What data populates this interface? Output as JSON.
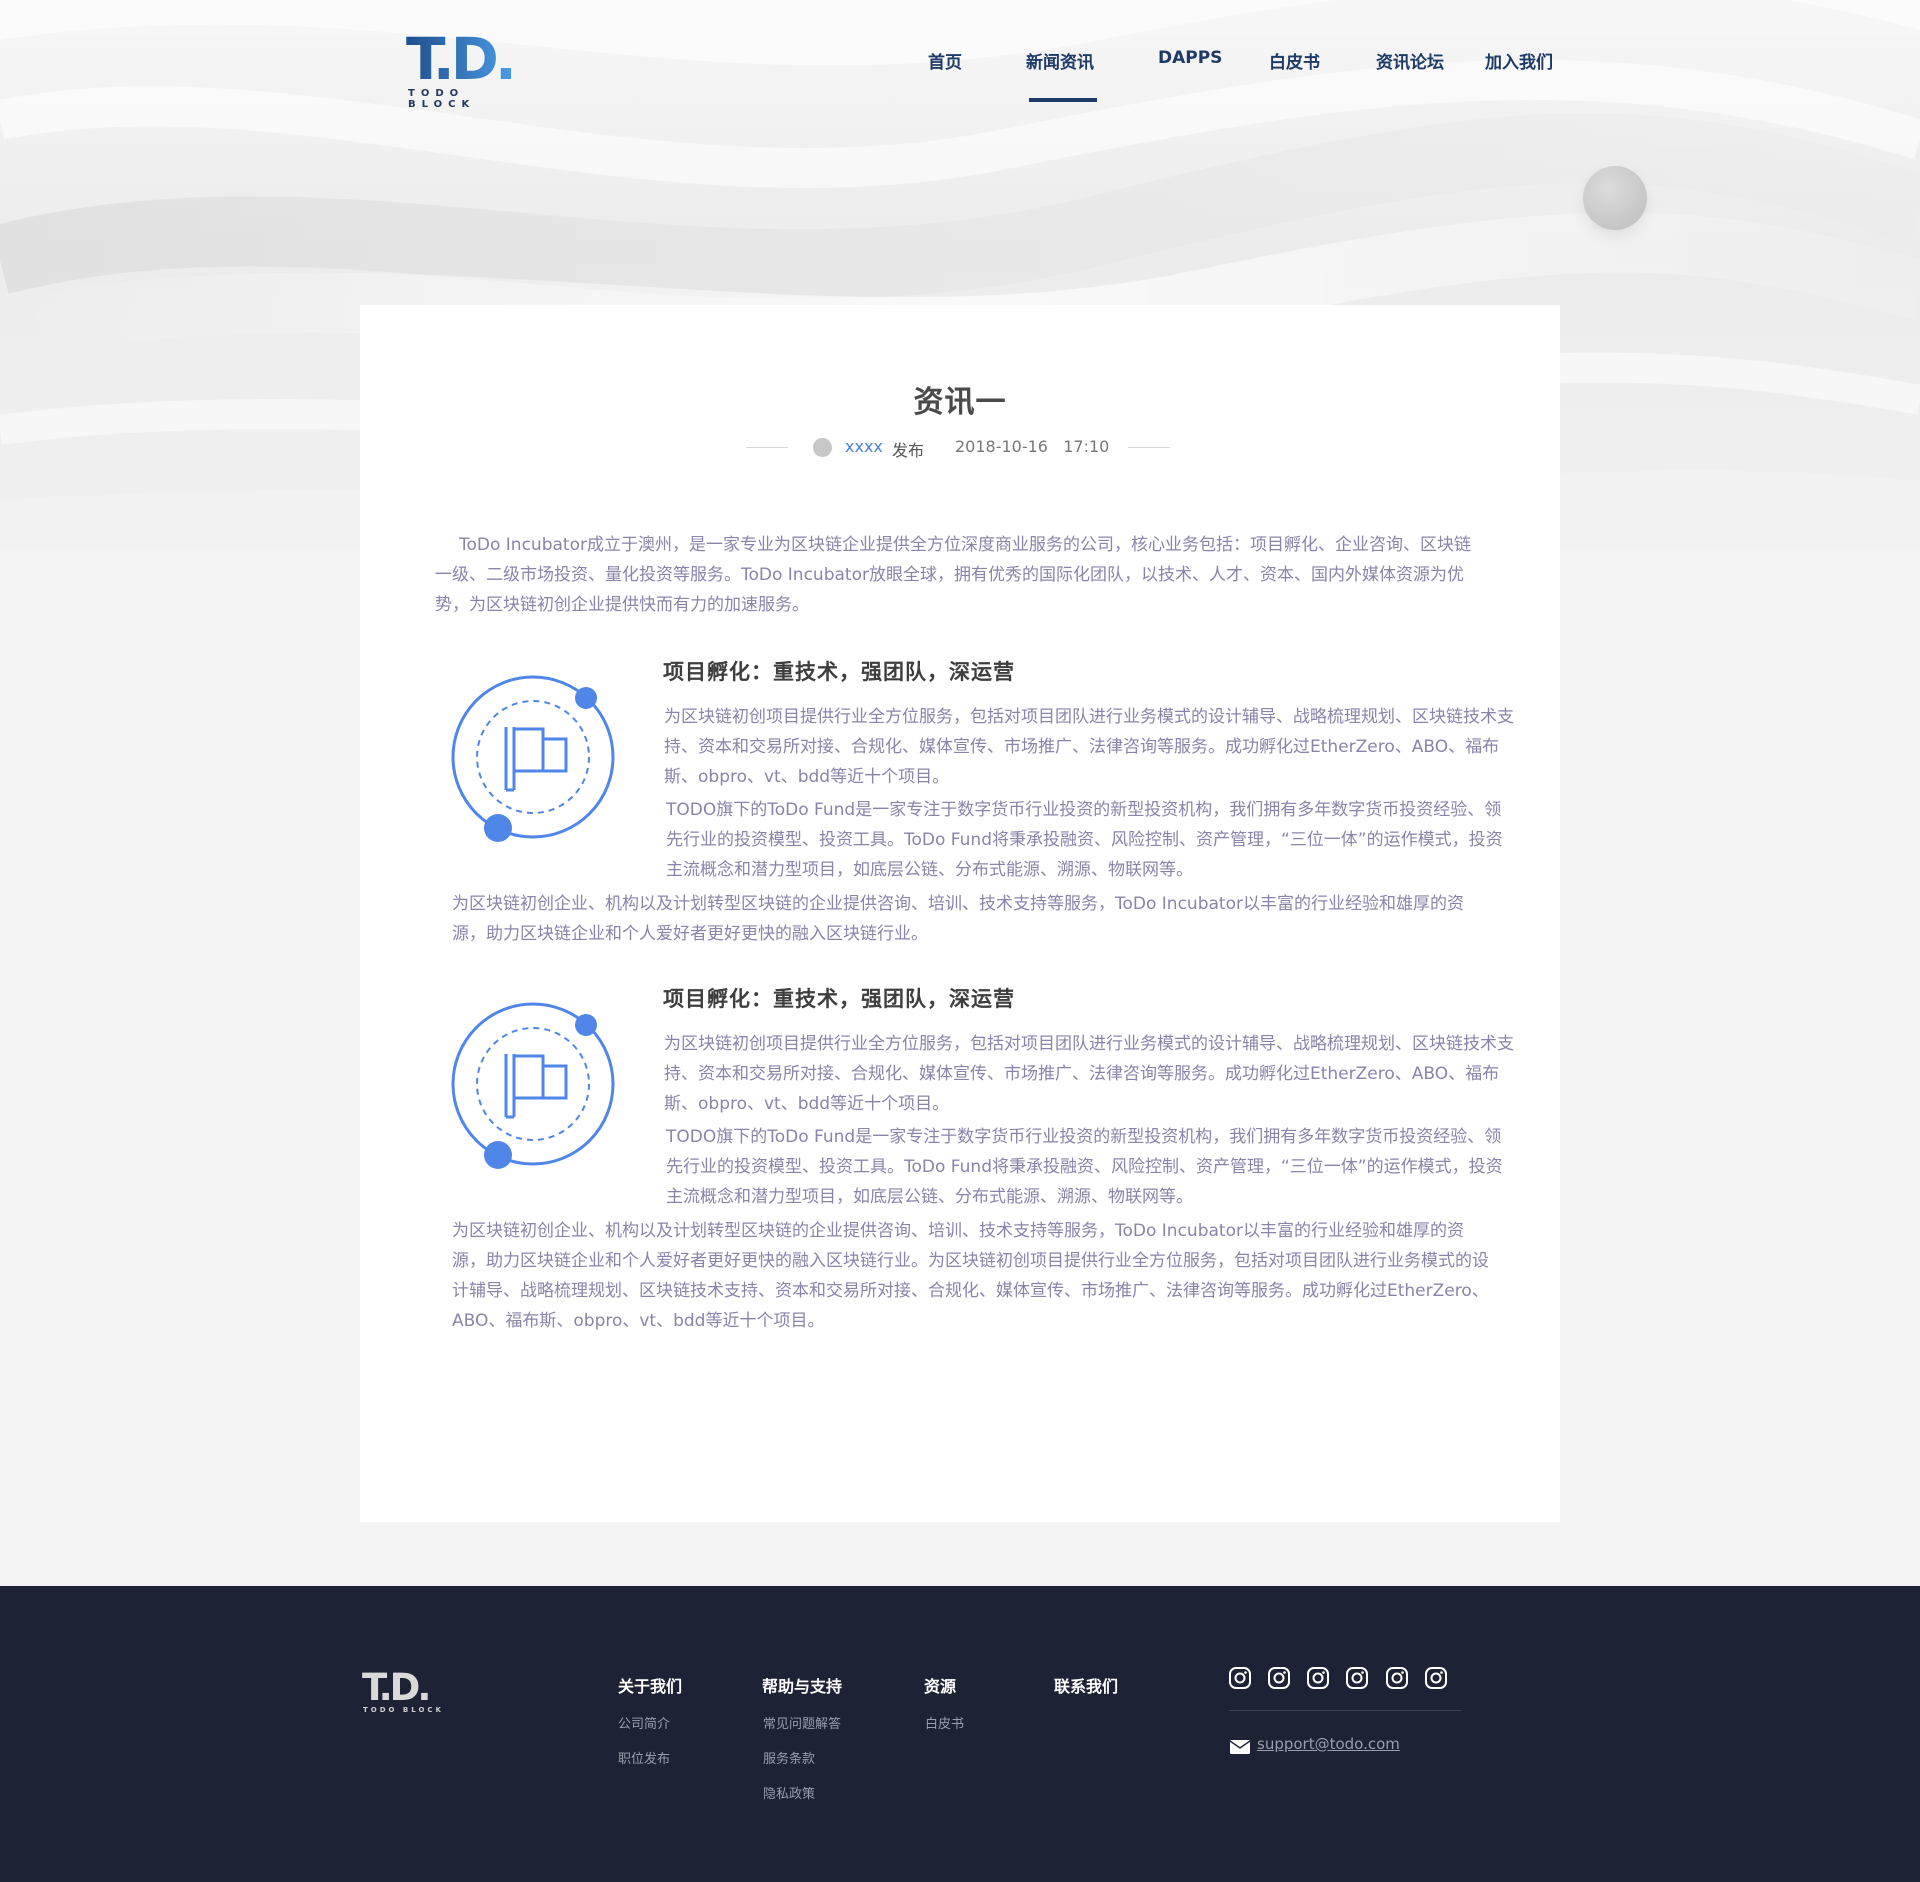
{
  "brand": {
    "logo_text": "T.D.",
    "logo_sub": "TODO BLOCK",
    "accent": "#1d3b66",
    "link_blue": "#4a7fd8",
    "body_text": "#8a84a8"
  },
  "nav": {
    "items": [
      {
        "label": "首页",
        "active": false
      },
      {
        "label": "新闻资讯",
        "active": true
      },
      {
        "label": "DAPPS",
        "active": false
      },
      {
        "label": "白皮书",
        "active": false
      },
      {
        "label": "资讯论坛",
        "active": false
      },
      {
        "label": "加入我们",
        "active": false
      }
    ]
  },
  "article": {
    "title": "资讯一",
    "author": "xxxx",
    "publish_label": "发布",
    "date": "2018-10-16",
    "time": "17:10",
    "intro": "ToDo Incubator成立于澳州，是一家专业为区块链企业提供全方位深度商业服务的公司，核心业务包括：项目孵化、企业咨询、区块链一级、二级市场投资、量化投资等服务。ToDo Incubator放眼全球，拥有优秀的国际化团队，以技术、人才、资本、国内外媒体资源为优势，为区块链初创企业提供快而有力的加速服务。",
    "sections": [
      {
        "icon": "flag-orbit-icon",
        "heading": "项目孵化：重技术，强团队，深运营",
        "p1": "为区块链初创项目提供行业全方位服务，包括对项目团队进行业务模式的设计辅导、战略梳理规划、区块链技术支持、资本和交易所对接、合规化、媒体宣传、市场推广、法律咨询等服务。成功孵化过EtherZero、ABO、福布斯、obpro、vt、bdd等近十个项目。",
        "p2": "TODO旗下的ToDo Fund是一家专注于数字货币行业投资的新型投资机构，我们拥有多年数字货币投资经验、领先行业的投资模型、投资工具。ToDo Fund将秉承投融资、风险控制、资产管理，“三位一体”的运作模式，投资主流概念和潜力型项目，如底层公链、分布式能源、溯源、物联网等。",
        "p3": "为区块链初创企业、机构以及计划转型区块链的企业提供咨询、培训、技术支持等服务，ToDo Incubator以丰富的行业经验和雄厚的资源，助力区块链企业和个人爱好者更好更快的融入区块链行业。"
      },
      {
        "icon": "flag-orbit-icon",
        "heading": "项目孵化：重技术，强团队，深运营",
        "p1": "为区块链初创项目提供行业全方位服务，包括对项目团队进行业务模式的设计辅导、战略梳理规划、区块链技术支持、资本和交易所对接、合规化、媒体宣传、市场推广、法律咨询等服务。成功孵化过EtherZero、ABO、福布斯、obpro、vt、bdd等近十个项目。",
        "p2": "TODO旗下的ToDo Fund是一家专注于数字货币行业投资的新型投资机构，我们拥有多年数字货币投资经验、领先行业的投资模型、投资工具。ToDo Fund将秉承投融资、风险控制、资产管理，“三位一体”的运作模式，投资主流概念和潜力型项目，如底层公链、分布式能源、溯源、物联网等。",
        "p3": "为区块链初创企业、机构以及计划转型区块链的企业提供咨询、培训、技术支持等服务，ToDo Incubator以丰富的行业经验和雄厚的资源，助力区块链企业和个人爱好者更好更快的融入区块链行业。为区块链初创项目提供行业全方位服务，包括对项目团队进行业务模式的设计辅导、战略梳理规划、区块链技术支持、资本和交易所对接、合规化、媒体宣传、市场推广、法律咨询等服务。成功孵化过EtherZero、ABO、福布斯、obpro、vt、bdd等近十个项目。"
      }
    ]
  },
  "footer": {
    "logo_text": "T.D.",
    "logo_sub": "TODO BLOCK",
    "columns": [
      {
        "title": "关于我们",
        "links": [
          "公司简介",
          "职位发布"
        ]
      },
      {
        "title": "帮助与支持",
        "links": [
          "常见问题解答",
          "服务条款",
          "隐私政策"
        ]
      },
      {
        "title": "资源",
        "links": [
          "白皮书"
        ]
      },
      {
        "title": "联系我们",
        "links": []
      }
    ],
    "social_icons": [
      "instagram-icon",
      "instagram-icon",
      "instagram-icon",
      "instagram-icon",
      "instagram-icon",
      "instagram-icon"
    ],
    "email": "support@todo.com"
  }
}
